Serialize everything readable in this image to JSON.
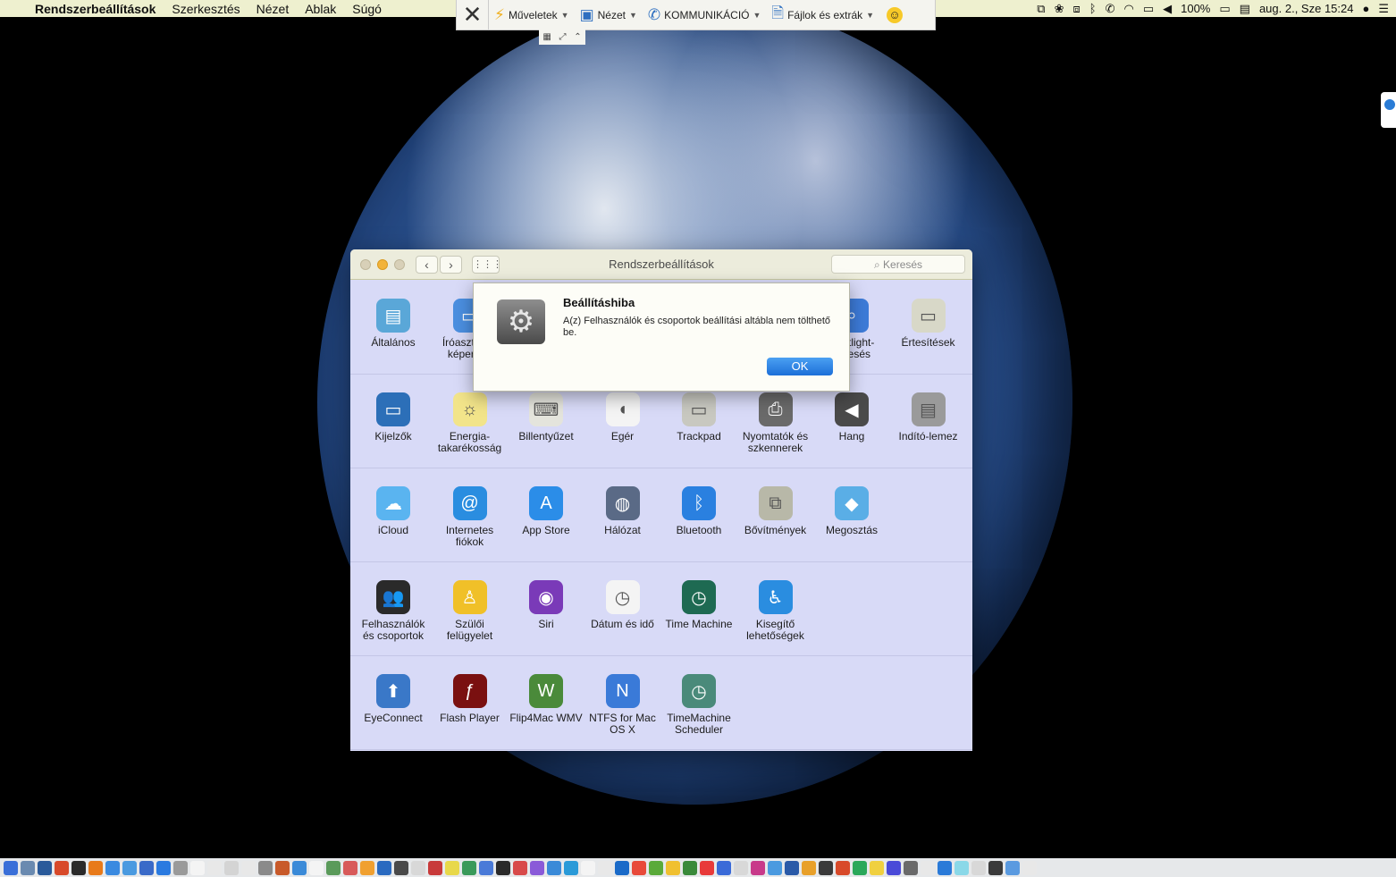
{
  "menubar": {
    "app_name": "Rendszerbeállítások",
    "items": [
      "Szerkesztés",
      "Nézet",
      "Ablak",
      "Súgó"
    ],
    "battery": "100%",
    "clock": "aug. 2., Sze  15:24"
  },
  "remote_toolbar": {
    "actions_label": "Műveletek",
    "view_label": "Nézet",
    "communication_label": "KOMMUNIKÁCIÓ",
    "files_label": "Fájlok és extrák"
  },
  "window": {
    "title": "Rendszerbeállítások",
    "search_placeholder": "Keresés"
  },
  "rows": [
    [
      {
        "label": "Általános",
        "icon": "general-icon",
        "color": "#5aa7d8"
      },
      {
        "label": "Íróasztal és képernyő",
        "icon": "desktop-icon",
        "color": "#4b8fe0"
      },
      {
        "label": "",
        "icon": "hidden-icon",
        "color": "#d8daf7"
      },
      {
        "label": "",
        "icon": "hidden-icon",
        "color": "#d8daf7"
      },
      {
        "label": "",
        "icon": "hidden-icon",
        "color": "#d8daf7"
      },
      {
        "label": "",
        "icon": "hidden-icon",
        "color": "#d8daf7"
      },
      {
        "label": "Spotlight-keresés",
        "icon": "spotlight-icon",
        "color": "#3d7bd8"
      },
      {
        "label": "Értesítések",
        "icon": "notifications-icon",
        "color": "#d8d8c8"
      }
    ],
    [
      {
        "label": "Kijelzők",
        "icon": "displays-icon",
        "color": "#2c6fb8"
      },
      {
        "label": "Energia-takarékosság",
        "icon": "energy-saver-icon",
        "color": "#f2e48a"
      },
      {
        "label": "Billentyűzet",
        "icon": "keyboard-icon",
        "color": "#e4e4dc"
      },
      {
        "label": "Egér",
        "icon": "mouse-icon",
        "color": "#f4f4f4"
      },
      {
        "label": "Trackpad",
        "icon": "trackpad-icon",
        "color": "#c8c8c0"
      },
      {
        "label": "Nyomtatók és szkennerek",
        "icon": "printer-icon",
        "color": "#6a6a6a"
      },
      {
        "label": "Hang",
        "icon": "sound-icon",
        "color": "#4a4a4a"
      },
      {
        "label": "Indító-lemez",
        "icon": "startup-disk-icon",
        "color": "#9a9a9a"
      }
    ],
    [
      {
        "label": "iCloud",
        "icon": "icloud-icon",
        "color": "#5ab4f0"
      },
      {
        "label": "Internetes fiókok",
        "icon": "internet-accounts-icon",
        "color": "#2a8de0"
      },
      {
        "label": "App Store",
        "icon": "app-store-icon",
        "color": "#2b8de8"
      },
      {
        "label": "Hálózat",
        "icon": "network-icon",
        "color": "#5a6a86"
      },
      {
        "label": "Bluetooth",
        "icon": "bluetooth-icon",
        "color": "#2a80e0"
      },
      {
        "label": "Bővítmények",
        "icon": "extensions-icon",
        "color": "#b8b8a8"
      },
      {
        "label": "Megosztás",
        "icon": "sharing-icon",
        "color": "#5aaee6"
      },
      {
        "label": "",
        "icon": "empty",
        "color": "#d8daf7"
      }
    ],
    [
      {
        "label": "Felhasználók és csoportok",
        "icon": "users-groups-icon",
        "color": "#2a2a2a"
      },
      {
        "label": "Szülői felügyelet",
        "icon": "parental-controls-icon",
        "color": "#f0c028"
      },
      {
        "label": "Siri",
        "icon": "siri-icon",
        "color": "#7a3ab8"
      },
      {
        "label": "Dátum és idő",
        "icon": "date-time-icon",
        "color": "#f4f4f4"
      },
      {
        "label": "Time Machine",
        "icon": "time-machine-icon",
        "color": "#1e6a52"
      },
      {
        "label": "Kisegítő lehetőségek",
        "icon": "accessibility-icon",
        "color": "#2a8de0"
      },
      {
        "label": "",
        "icon": "empty",
        "color": "#d8daf7"
      },
      {
        "label": "",
        "icon": "empty",
        "color": "#d8daf7"
      }
    ],
    [
      {
        "label": "EyeConnect",
        "icon": "eyeconnect-icon",
        "color": "#3a78c8"
      },
      {
        "label": "Flash Player",
        "icon": "flash-player-icon",
        "color": "#7a1010"
      },
      {
        "label": "Flip4Mac WMV",
        "icon": "flip4mac-icon",
        "color": "#4a8a3a"
      },
      {
        "label": "NTFS for Mac OS X",
        "icon": "ntfs-icon",
        "color": "#3a7ad8"
      },
      {
        "label": "TimeMachine Scheduler",
        "icon": "timemachine-scheduler-icon",
        "color": "#4a8a7a"
      },
      {
        "label": "",
        "icon": "empty",
        "color": "#d8daf7"
      },
      {
        "label": "",
        "icon": "empty",
        "color": "#d8daf7"
      },
      {
        "label": "",
        "icon": "empty",
        "color": "#d8daf7"
      }
    ]
  ],
  "alert": {
    "title": "Beállításhiba",
    "message": "A(z) Felhasználók és csoportok beállítási altábla nem tölthető be.",
    "ok_label": "OK"
  },
  "dock_colors": [
    "#3a6fd8",
    "#6a8ab0",
    "#2a5a9a",
    "#d84a2a",
    "#2a2a2a",
    "#e87a1a",
    "#3a8ae0",
    "#4a9ae0",
    "#3a6ac8",
    "#2a7ae0",
    "#9a9a9a",
    "#f4f4f4",
    "#e8e8e8",
    "#d4d4d4",
    "#e8e8e8",
    "#8a8a8a",
    "#c85a2a",
    "#3a8ad8",
    "#f4f4f4",
    "#5a9a5a",
    "#d85a5a",
    "#f0a030",
    "#2a6ac0",
    "#4a4a4a",
    "#d8d8d8",
    "#c83a3a",
    "#e8d84a",
    "#3a9a5a",
    "#4a7ad8",
    "#2a2a2a",
    "#d84a4a",
    "#8a5ad8",
    "#3a8ad8",
    "#2a9ad8",
    "#f4f4f4",
    "#e8e8e8",
    "#1a6ac8",
    "#e84a3a",
    "#5aaa3a",
    "#f0c030",
    "#3a8a3a",
    "#e83a3a",
    "#3a6ad8",
    "#d8d8d8",
    "#c83a8a",
    "#4a9ae0",
    "#2a5aa8",
    "#e8a02a",
    "#3a3a3a",
    "#d84a2a",
    "#2aa85a",
    "#f0d040",
    "#4a4ad8",
    "#6a6a6a",
    "#e8e8e8",
    "#2a7ad8",
    "#8ad8e8",
    "#d8d8d8",
    "#3a3a3a",
    "#5a9ae0",
    "#e8e8e8"
  ]
}
